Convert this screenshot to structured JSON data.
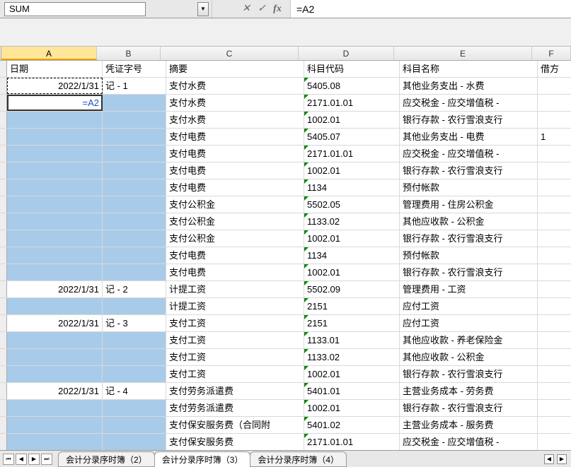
{
  "nameBox": "SUM",
  "formula": "=A2",
  "colLabels": [
    "A",
    "B",
    "C",
    "D",
    "E",
    "F"
  ],
  "headers": {
    "A": "日期",
    "B": "凭证字号",
    "C": "摘要",
    "D": "科目代码",
    "E": "科目名称",
    "F": "借方"
  },
  "rows": [
    {
      "A": "2022/1/31",
      "B": "记 - 1",
      "C": "支付水费",
      "D": "5405.08",
      "E": "其他业务支出 - 水费",
      "F": ""
    },
    {
      "A": "=A2",
      "B": "",
      "C": "支付水费",
      "D": "2171.01.01",
      "E": "应交税金 - 应交增值税 -",
      "F": ""
    },
    {
      "A": "",
      "B": "",
      "C": "支付水费",
      "D": "1002.01",
      "E": "银行存款 - 农行雪浪支行",
      "F": ""
    },
    {
      "A": "",
      "B": "",
      "C": "支付电费",
      "D": "5405.07",
      "E": "其他业务支出 - 电费",
      "F": "1"
    },
    {
      "A": "",
      "B": "",
      "C": "支付电费",
      "D": "2171.01.01",
      "E": "应交税金 - 应交增值税 -",
      "F": ""
    },
    {
      "A": "",
      "B": "",
      "C": "支付电费",
      "D": "1002.01",
      "E": "银行存款 - 农行雪浪支行",
      "F": ""
    },
    {
      "A": "",
      "B": "",
      "C": "支付电费",
      "D": "1134",
      "E": "预付帐款",
      "F": ""
    },
    {
      "A": "",
      "B": "",
      "C": "支付公积金",
      "D": "5502.05",
      "E": "管理费用 - 住房公积金",
      "F": ""
    },
    {
      "A": "",
      "B": "",
      "C": "支付公积金",
      "D": "1133.02",
      "E": "其他应收款 - 公积金",
      "F": ""
    },
    {
      "A": "",
      "B": "",
      "C": "支付公积金",
      "D": "1002.01",
      "E": "银行存款 - 农行雪浪支行",
      "F": ""
    },
    {
      "A": "",
      "B": "",
      "C": "支付电费",
      "D": "1134",
      "E": "预付帐款",
      "F": ""
    },
    {
      "A": "",
      "B": "",
      "C": "支付电费",
      "D": "1002.01",
      "E": "银行存款 - 农行雪浪支行",
      "F": ""
    },
    {
      "A": "2022/1/31",
      "B": "记 - 2",
      "C": "计提工资",
      "D": "5502.09",
      "E": "管理费用 - 工资",
      "F": ""
    },
    {
      "A": "",
      "B": "",
      "C": "计提工资",
      "D": "2151",
      "E": "应付工资",
      "F": ""
    },
    {
      "A": "2022/1/31",
      "B": "记 - 3",
      "C": "支付工资",
      "D": "2151",
      "E": "应付工资",
      "F": ""
    },
    {
      "A": "",
      "B": "",
      "C": "支付工资",
      "D": "1133.01",
      "E": "其他应收款 - 养老保险金",
      "F": ""
    },
    {
      "A": "",
      "B": "",
      "C": "支付工资",
      "D": "1133.02",
      "E": "其他应收款 - 公积金",
      "F": ""
    },
    {
      "A": "",
      "B": "",
      "C": "支付工资",
      "D": "1002.01",
      "E": "银行存款 - 农行雪浪支行",
      "F": ""
    },
    {
      "A": "2022/1/31",
      "B": "记 - 4",
      "C": "支付劳务派遣费",
      "D": "5401.01",
      "E": "主营业务成本 - 劳务费",
      "F": ""
    },
    {
      "A": "",
      "B": "",
      "C": "支付劳务派遣费",
      "D": "1002.01",
      "E": "银行存款 - 农行雪浪支行",
      "F": ""
    },
    {
      "A": "",
      "B": "",
      "C": "支付保安服务费（合同附",
      "D": "5401.02",
      "E": "主营业务成本 - 服务费",
      "F": ""
    },
    {
      "A": "",
      "B": "",
      "C": "支付保安服务费",
      "D": "2171.01.01",
      "E": "应交税金 - 应交增值税 -",
      "F": ""
    }
  ],
  "blankSelectedRows": [
    2,
    3,
    4,
    5,
    6,
    7,
    8,
    9,
    10,
    11
  ],
  "activeRow": 1,
  "marchingRow": 0,
  "tabs": [
    {
      "label": "会计分录序时簿（2）",
      "active": false
    },
    {
      "label": "会计分录序时簿（3）",
      "active": true
    },
    {
      "label": "会计分录序时簿（4）",
      "active": false
    }
  ]
}
